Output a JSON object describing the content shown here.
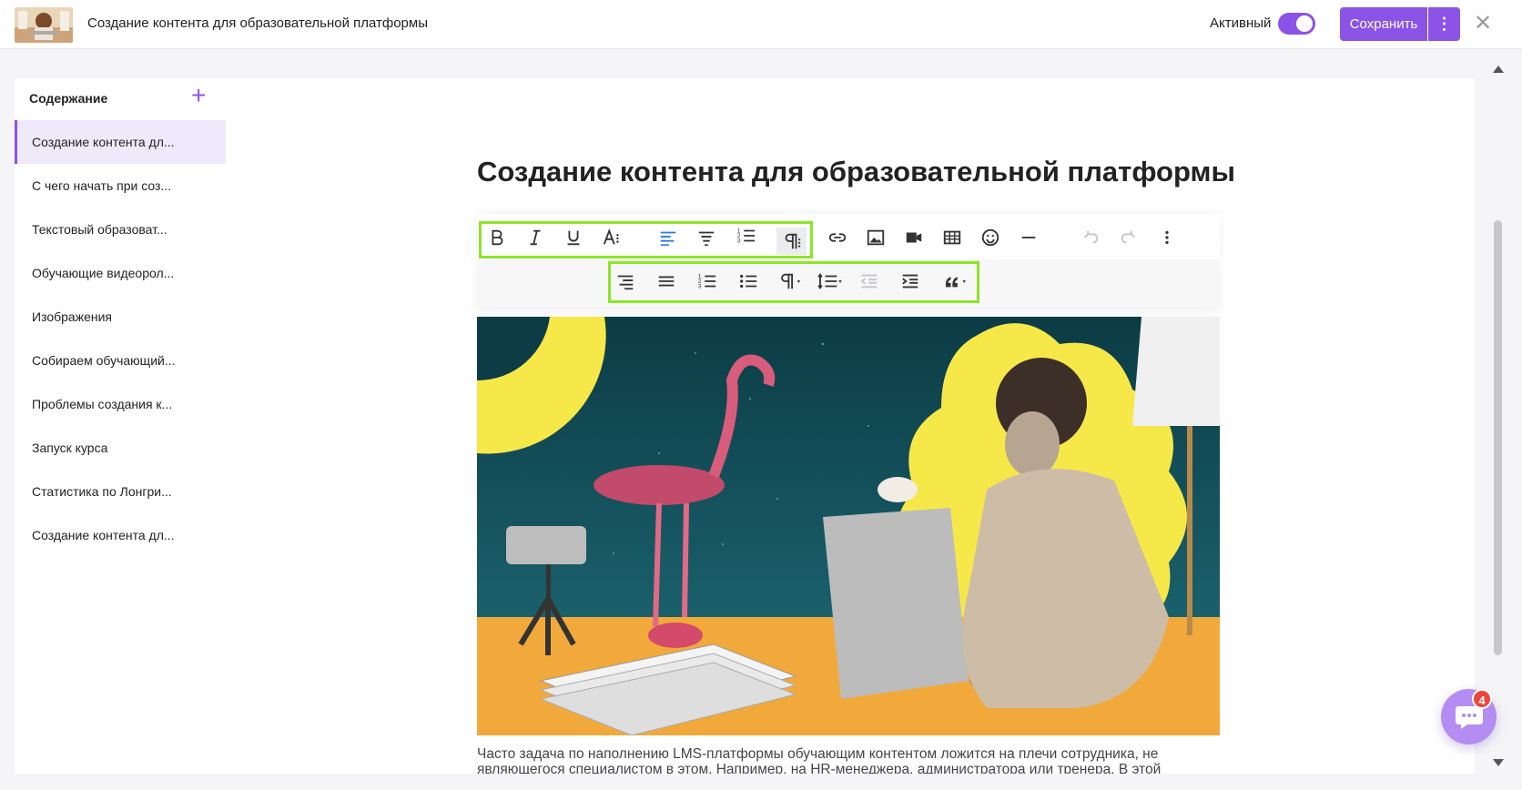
{
  "header": {
    "title": "Создание контента для образовательной платформы",
    "active_label": "Активный",
    "save_label": "Сохранить",
    "more_label": "⋮",
    "close_label": "✕"
  },
  "sidebar": {
    "title": "Содержание",
    "add_label": "+",
    "items": [
      "Создание контента дл...",
      "С чего начать при соз...",
      "Текстовый образоват...",
      "Обучающие видеорол...",
      "Изображения",
      "Собираем обучающий...",
      "Проблемы создания к...",
      "Запуск курса",
      "Статистика по Лонгри...",
      "Создание контента дл..."
    ]
  },
  "editor": {
    "heading": "Создание контента для образовательной платформы",
    "body_line_1": "Часто задача по наполнению LMS-платформы обучающим контентом ложится на плечи сотрудника, не",
    "body_line_2": "являющегося специалистом в этом. Например, на HR-менеджера, администратора или тренера. В этой"
  },
  "toolbar": {
    "row1_icons": [
      "bold-icon",
      "italic-icon",
      "underline-icon",
      "font-size-icon",
      "align-left-icon",
      "align-center-icon",
      "ordered-list-icon",
      "paragraph-format-icon",
      "link-icon",
      "image-icon",
      "video-icon",
      "table-icon",
      "emoji-icon",
      "horizontal-rule-icon",
      "undo-icon",
      "redo-icon",
      "more-vertical-icon"
    ],
    "row2_icons": [
      "align-right-icon",
      "align-justify-icon",
      "numbered-list-icon",
      "bulleted-list-icon",
      "paragraph-style-icon",
      "line-height-icon",
      "outdent-icon",
      "indent-icon",
      "quote-icon"
    ]
  },
  "chat": {
    "badge_count": "4"
  },
  "colors": {
    "accent": "#8b53e6",
    "highlight": "#8be626",
    "badge": "#f04438"
  }
}
